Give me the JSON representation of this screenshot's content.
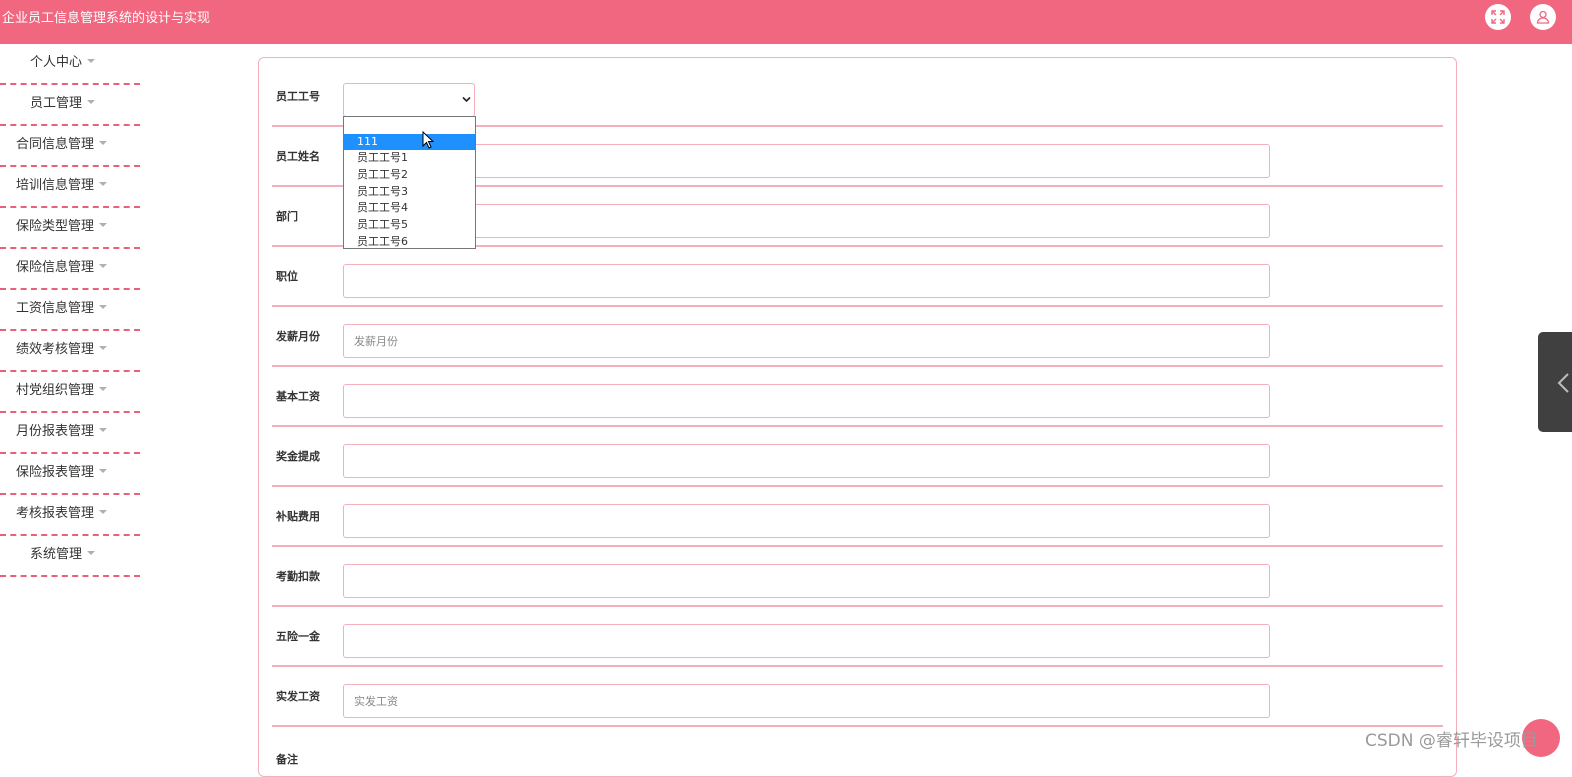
{
  "header": {
    "title": "企业员工信息管理系统的设计与实现",
    "icons": [
      "expand-icon",
      "user-icon"
    ],
    "bg_color": "#f0677f"
  },
  "sidebar": {
    "items": [
      {
        "label": "个人中心"
      },
      {
        "label": "员工管理"
      },
      {
        "label": "合同信息管理"
      },
      {
        "label": "培训信息管理"
      },
      {
        "label": "保险类型管理"
      },
      {
        "label": "保险信息管理"
      },
      {
        "label": "工资信息管理"
      },
      {
        "label": "绩效考核管理"
      },
      {
        "label": "村党组织管理"
      },
      {
        "label": "月份报表管理"
      },
      {
        "label": "保险报表管理"
      },
      {
        "label": "考核报表管理"
      },
      {
        "label": "系统管理"
      }
    ]
  },
  "form": {
    "fields": [
      {
        "label": "员工工号",
        "type": "select",
        "value": ""
      },
      {
        "label": "员工姓名",
        "value": ""
      },
      {
        "label": "部门",
        "value": ""
      },
      {
        "label": "职位",
        "value": ""
      },
      {
        "label": "发薪月份",
        "placeholder": "发薪月份"
      },
      {
        "label": "基本工资",
        "value": ""
      },
      {
        "label": "奖金提成",
        "value": ""
      },
      {
        "label": "补贴费用",
        "value": ""
      },
      {
        "label": "考勤扣款",
        "value": ""
      },
      {
        "label": "五险一金",
        "value": ""
      },
      {
        "label": "实发工资",
        "placeholder": "实发工资"
      },
      {
        "label": "备注"
      }
    ],
    "dropdown": {
      "options": [
        "",
        "111",
        "员工工号1",
        "员工工号2",
        "员工工号3",
        "员工工号4",
        "员工工号5",
        "员工工号6"
      ],
      "highlighted": "111"
    }
  },
  "watermark": "CSDN @睿轩毕设项目"
}
